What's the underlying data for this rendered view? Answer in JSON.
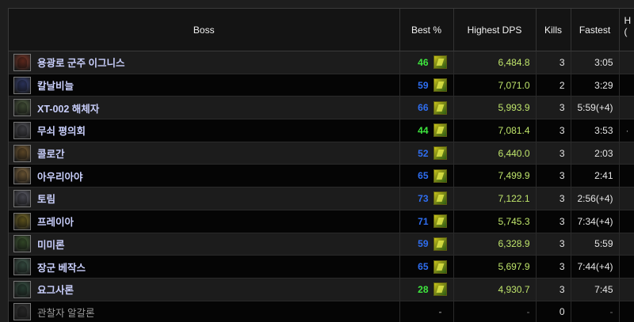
{
  "headers": {
    "boss": "Boss",
    "best_pct": "Best %",
    "highest_dps": "Highest DPS",
    "kills": "Kills",
    "fastest": "Fastest",
    "extra_line1": "H",
    "extra_line2": "("
  },
  "rows": [
    {
      "boss": "용광로 군주 이그니스",
      "best": "46",
      "best_color": "#3ee63e",
      "dps": "6,484.8",
      "kills": "3",
      "fastest": "3:05",
      "extra": "",
      "icon_color": "#8a3b2a",
      "dim": false
    },
    {
      "boss": "칼날비늘",
      "best": "59",
      "best_color": "#2f6ef0",
      "dps": "7,071.0",
      "kills": "2",
      "fastest": "3:29",
      "extra": "",
      "icon_color": "#3e4a86",
      "dim": false
    },
    {
      "boss": "XT-002 해체자",
      "best": "66",
      "best_color": "#2f6ef0",
      "dps": "5,993.9",
      "kills": "3",
      "fastest": "5:59(+4)",
      "extra": "",
      "icon_color": "#5a6b4a",
      "dim": false
    },
    {
      "boss": "무쇠 평의회",
      "best": "44",
      "best_color": "#3ee63e",
      "dps": "7,081.4",
      "kills": "3",
      "fastest": "3:53",
      "extra": "·",
      "icon_color": "#5e5e66",
      "dim": false
    },
    {
      "boss": "콜로간",
      "best": "52",
      "best_color": "#2f6ef0",
      "dps": "6,440.0",
      "kills": "3",
      "fastest": "2:03",
      "extra": "",
      "icon_color": "#8a6a3a",
      "dim": false
    },
    {
      "boss": "아우리아야",
      "best": "65",
      "best_color": "#2f6ef0",
      "dps": "7,499.9",
      "kills": "3",
      "fastest": "2:41",
      "extra": "",
      "icon_color": "#9a7a4a",
      "dim": false
    },
    {
      "boss": "토림",
      "best": "73",
      "best_color": "#2f6ef0",
      "dps": "7,122.1",
      "kills": "3",
      "fastest": "2:56(+4)",
      "extra": "",
      "icon_color": "#6a6a78",
      "dim": false
    },
    {
      "boss": "프레이아",
      "best": "71",
      "best_color": "#2f6ef0",
      "dps": "5,745.3",
      "kills": "3",
      "fastest": "7:34(+4)",
      "extra": "",
      "icon_color": "#8a7a2a",
      "dim": false
    },
    {
      "boss": "미미론",
      "best": "59",
      "best_color": "#2f6ef0",
      "dps": "6,328.9",
      "kills": "3",
      "fastest": "5:59",
      "extra": "",
      "icon_color": "#4a6a3a",
      "dim": false
    },
    {
      "boss": "장군 베작스",
      "best": "65",
      "best_color": "#2f6ef0",
      "dps": "5,697.9",
      "kills": "3",
      "fastest": "7:44(+4)",
      "extra": "",
      "icon_color": "#4a6a5a",
      "dim": false
    },
    {
      "boss": "요그사론",
      "best": "28",
      "best_color": "#3ee63e",
      "dps": "4,930.7",
      "kills": "3",
      "fastest": "7:45",
      "extra": "",
      "icon_color": "#3a5a4a",
      "dim": false
    },
    {
      "boss": "관찰자 알갈론",
      "best": "-",
      "best_color": "#777777",
      "dps": "-",
      "kills": "0",
      "fastest": "-",
      "extra": "",
      "icon_color": "#3a3a3a",
      "dim": true
    }
  ]
}
